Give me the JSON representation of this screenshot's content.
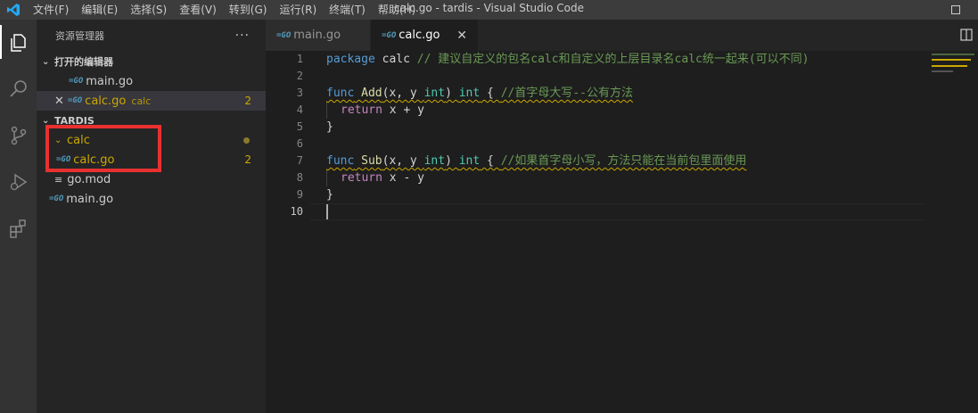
{
  "titlebar": {
    "menu": [
      "文件(F)",
      "编辑(E)",
      "选择(S)",
      "查看(V)",
      "转到(G)",
      "运行(R)",
      "终端(T)",
      "帮助(H)"
    ],
    "window_title": "calc.go - tardis - Visual Studio Code"
  },
  "activitybar": {
    "icons": [
      "explorer-icon",
      "search-icon",
      "source-control-icon",
      "run-debug-icon",
      "extensions-icon"
    ]
  },
  "sidebar": {
    "title": "资源管理器",
    "more": "···",
    "open_editors": {
      "label": "打开的编辑器",
      "items": [
        {
          "name": "main.go"
        },
        {
          "name": "calc.go",
          "desc": "calc",
          "badge": "2"
        }
      ]
    },
    "workspace": {
      "label": "TARDIS",
      "folder": "calc",
      "folder_file": "calc.go",
      "folder_file_badge": "2",
      "files": [
        "go.mod",
        "main.go"
      ]
    }
  },
  "tabs": [
    {
      "label": "main.go"
    },
    {
      "label": "calc.go",
      "close": "✕"
    }
  ],
  "editor": {
    "line_numbers": [
      "1",
      "2",
      "3",
      "4",
      "5",
      "6",
      "7",
      "8",
      "9",
      "10"
    ],
    "line1": {
      "kw": "package",
      "rest": " calc ",
      "comment": "// 建议自定义的包名calc和自定义的上层目录名calc统一起来(可以不同)"
    },
    "line3": {
      "kw": "func",
      "name": "Add",
      "params1": "(x, y ",
      "ptype": "int",
      "params2": ") ",
      "rtype": "int",
      "brace": " { ",
      "comment": "//首字母大写--公有方法"
    },
    "line4": {
      "kw": "return",
      "expr": " x + y"
    },
    "line5": {
      "brace": "}"
    },
    "line7": {
      "kw": "func",
      "name": "Sub",
      "params1": "(x, y ",
      "ptype": "int",
      "params2": ") ",
      "rtype": "int",
      "brace": " { ",
      "comment": "//如果首字母小写，方法只能在当前包里面使用"
    },
    "line8": {
      "kw": "return",
      "expr": " x - y"
    },
    "line9": {
      "brace": "}"
    }
  },
  "colors": {
    "warning": "#cca700",
    "highlight_box": "#e8312f",
    "go_icon": "#519aba"
  }
}
